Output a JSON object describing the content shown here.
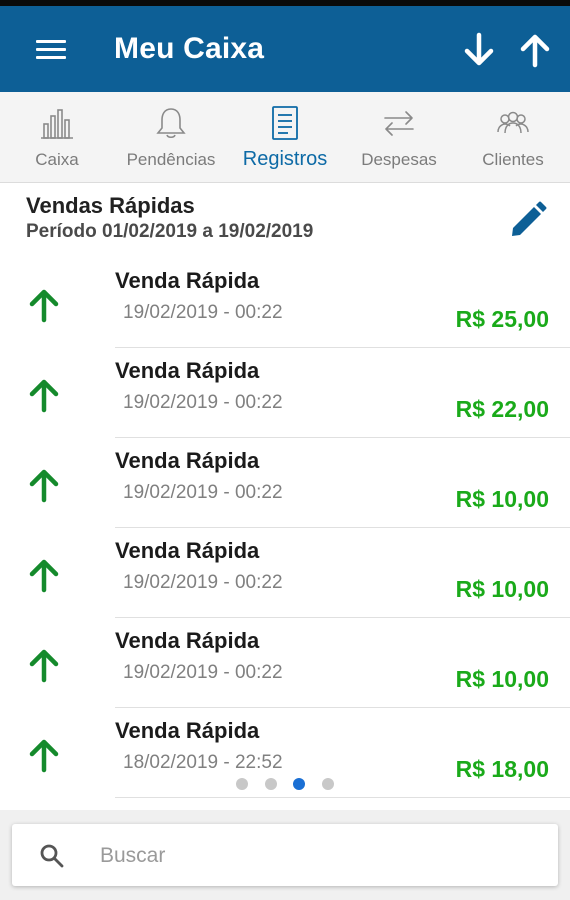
{
  "app": {
    "title": "Meu Caixa"
  },
  "tabs": [
    {
      "label": "Caixa",
      "icon": "bar-chart-icon"
    },
    {
      "label": "Pendências",
      "icon": "bell-icon"
    },
    {
      "label": "Registros",
      "icon": "document-icon",
      "active": true
    },
    {
      "label": "Despesas",
      "icon": "swap-arrows-icon"
    },
    {
      "label": "Clientes",
      "icon": "people-icon"
    }
  ],
  "section": {
    "title": "Vendas Rápidas",
    "period": "Período 01/02/2019 a 19/02/2019"
  },
  "records": [
    {
      "title": "Venda Rápida",
      "date": "19/02/2019 - 00:22",
      "amount": "R$ 25,00"
    },
    {
      "title": "Venda Rápida",
      "date": "19/02/2019 - 00:22",
      "amount": "R$ 22,00"
    },
    {
      "title": "Venda Rápida",
      "date": "19/02/2019 - 00:22",
      "amount": "R$ 10,00"
    },
    {
      "title": "Venda Rápida",
      "date": "19/02/2019 - 00:22",
      "amount": "R$ 10,00"
    },
    {
      "title": "Venda Rápida",
      "date": "19/02/2019 - 00:22",
      "amount": "R$ 10,00"
    },
    {
      "title": "Venda Rápida",
      "date": "18/02/2019 - 22:52",
      "amount": "R$ 18,00"
    }
  ],
  "pager": {
    "count": 4,
    "active_index": 2
  },
  "search": {
    "placeholder": "Buscar",
    "value": ""
  },
  "colors": {
    "appbar": "#0d5f96",
    "accent": "#0d6aa6",
    "income": "#1aaa1a",
    "arrow": "#158a2c"
  }
}
